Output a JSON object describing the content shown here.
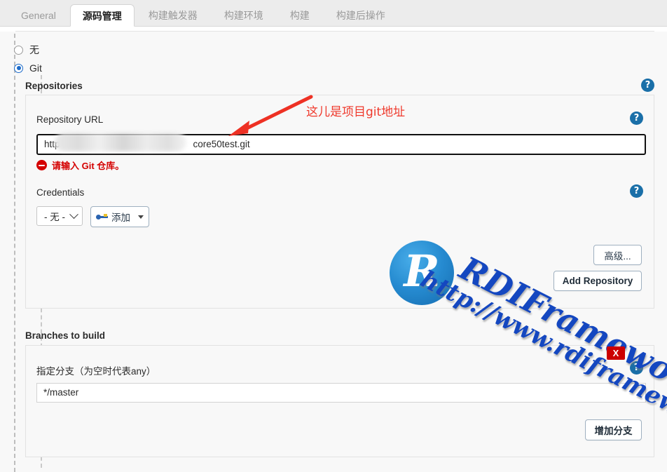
{
  "tabs": [
    {
      "label": "General",
      "active": false
    },
    {
      "label": "源码管理",
      "active": true
    },
    {
      "label": "构建触发器",
      "active": false
    },
    {
      "label": "构建环境",
      "active": false
    },
    {
      "label": "构建",
      "active": false
    },
    {
      "label": "构建后操作",
      "active": false
    }
  ],
  "scm": {
    "options": [
      {
        "label": "无",
        "selected": false
      },
      {
        "label": "Git",
        "selected": true
      }
    ]
  },
  "repositories": {
    "section_label": "Repositories",
    "url_label": "Repository URL",
    "url_value_prefix": "http",
    "url_value_suffix": "core50test.git",
    "url_error": "请输入 Git 仓库。",
    "credentials_label": "Credentials",
    "credentials_selected": "- 无 -",
    "add_credentials_label": "添加",
    "advanced_label": "高级...",
    "add_repository_label": "Add Repository"
  },
  "branches": {
    "section_label": "Branches to build",
    "specifier_label": "指定分支（为空时代表any）",
    "specifier_value": "*/master",
    "add_branch_label": "增加分支"
  },
  "help": {
    "glyph": "?"
  },
  "annotation": {
    "text": "这儿是项目git地址"
  },
  "watermark": {
    "logo_letter": "R",
    "brand": "RDIFramework.NET",
    "url": "http://www.rdiframework.net",
    "close_label": "X"
  },
  "colors": {
    "accent": "#1b6ac9",
    "help": "#1a6fa8",
    "error": "#d40000",
    "annotation": "#ef3a2d",
    "watermark": "#1447c0"
  }
}
